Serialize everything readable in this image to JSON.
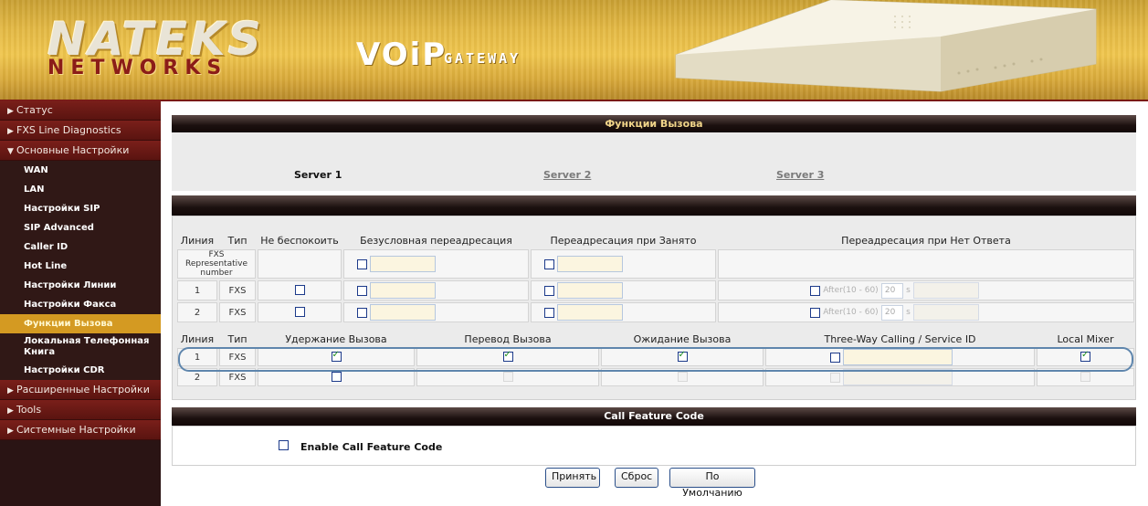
{
  "header": {
    "logo_top": "NATEKS",
    "logo_bottom": "NETWORKS",
    "product_big": "VOiP",
    "product_small": "GATEWAY"
  },
  "sidebar": {
    "sections": [
      {
        "label": "Статус",
        "expanded": false
      },
      {
        "label": "FXS Line Diagnostics",
        "expanded": false
      },
      {
        "label": "Основные Настройки",
        "expanded": true
      }
    ],
    "items": [
      {
        "label": "WAN"
      },
      {
        "label": "LAN"
      },
      {
        "label": "Настройки SIP"
      },
      {
        "label": "SIP Advanced"
      },
      {
        "label": "Caller ID"
      },
      {
        "label": "Hot Line"
      },
      {
        "label": "Настройки Линии"
      },
      {
        "label": "Настройки Факса"
      },
      {
        "label": "Функции Вызова",
        "active": true
      },
      {
        "label": "Локальная Телефонная Книга"
      },
      {
        "label": "Настройки CDR"
      }
    ],
    "sections_after": [
      {
        "label": "Расширенные Настройки"
      },
      {
        "label": "Tools"
      },
      {
        "label": "Системные Настройки"
      }
    ]
  },
  "main": {
    "title": "Функции Вызова",
    "servers": [
      "Server 1",
      "Server 2",
      "Server 3"
    ],
    "forward_table": {
      "headers": [
        "Линия",
        "Тип",
        "Не беспокоить",
        "Безусловная переадресация",
        "Переадресация при Занято",
        "Переадресация при Нет Ответа"
      ],
      "representative_label": "FXS Representative number",
      "after_label": "After(10 - 60)",
      "after_value": "20",
      "after_unit": "s",
      "rows": [
        {
          "line": "1",
          "type": "FXS"
        },
        {
          "line": "2",
          "type": "FXS"
        }
      ]
    },
    "feature_table": {
      "headers": [
        "Линия",
        "Тип",
        "Удержание Вызова",
        "Перевод Вызова",
        "Ожидание Вызова",
        "Three-Way Calling / Service ID",
        "Local Mixer"
      ],
      "rows": [
        {
          "line": "1",
          "type": "FXS",
          "hold": true,
          "transfer": true,
          "waiting": true,
          "three_way": false,
          "mixer": true
        },
        {
          "line": "2",
          "type": "FXS",
          "hold": false,
          "transfer": false,
          "waiting": false,
          "three_way": false,
          "mixer": false
        }
      ]
    },
    "cfc_title": "Call Feature Code",
    "cfc_label": "Enable Call Feature Code"
  },
  "buttons": {
    "apply": "Принять",
    "reset": "Сброс",
    "default": "По Умолчанию"
  },
  "colors": {
    "accent_header": "#e4b944",
    "sidebar_bg": "#2a1414",
    "section_bg": "#7a1f1a",
    "active_item": "#d49a22",
    "panel_title": "#f0d489"
  }
}
